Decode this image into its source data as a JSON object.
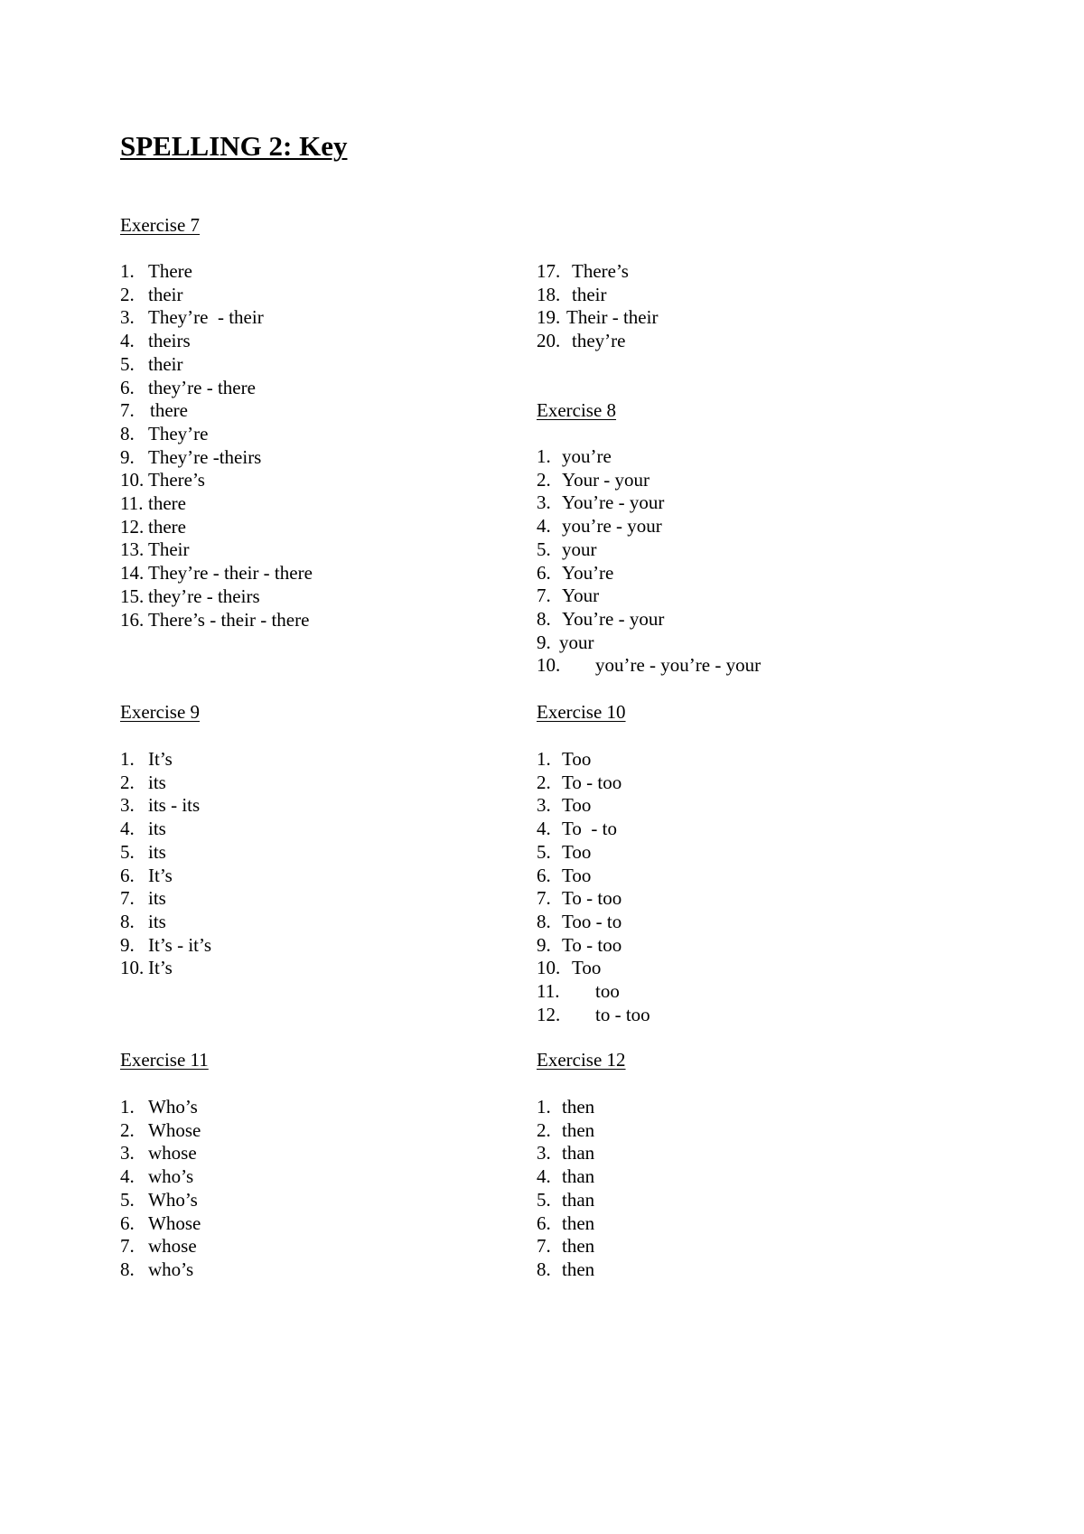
{
  "document": {
    "title": "SPELLING 2: Key"
  },
  "exercises": [
    {
      "header": "Exercise 7",
      "items": [
        {
          "num": "1.",
          "text": "There"
        },
        {
          "num": "2.",
          "text": "their"
        },
        {
          "num": "3.",
          "text": "They’re  - their"
        },
        {
          "num": "4.",
          "text": "theirs"
        },
        {
          "num": "5.",
          "text": "their"
        },
        {
          "num": "6.",
          "text": "they’re - there"
        },
        {
          "num": "7.",
          "text": "there"
        },
        {
          "num": "8.",
          "text": "They’re"
        },
        {
          "num": "9.",
          "text": "They’re -theirs"
        },
        {
          "num": "10.",
          "text": "There’s"
        },
        {
          "num": "11.",
          "text": "there"
        },
        {
          "num": "12.",
          "text": "there"
        },
        {
          "num": "13.",
          "text": "Their"
        },
        {
          "num": "14.",
          "text": "They’re - their - there"
        },
        {
          "num": "15.",
          "text": "they’re - theirs"
        },
        {
          "num": "16.",
          "text": "There’s - their - there"
        },
        {
          "num": "17.",
          "text": "There’s"
        },
        {
          "num": "18.",
          "text": "their"
        },
        {
          "num": "19.",
          "text": "Their - their"
        },
        {
          "num": "20.",
          "text": "they’re"
        }
      ]
    },
    {
      "header": "Exercise 8",
      "items": [
        {
          "num": "1.",
          "text": "you’re"
        },
        {
          "num": "2.",
          "text": "Your - your"
        },
        {
          "num": "3.",
          "text": "You’re - your"
        },
        {
          "num": "4.",
          "text": "you’re - your"
        },
        {
          "num": "5.",
          "text": "your"
        },
        {
          "num": "6.",
          "text": "You’re"
        },
        {
          "num": "7.",
          "text": "Your"
        },
        {
          "num": "8.",
          "text": "You’re - your"
        },
        {
          "num": "9.",
          "text": "your"
        },
        {
          "num": "10.",
          "text": "you’re - you’re - your"
        }
      ]
    },
    {
      "header": "Exercise 9",
      "items": [
        {
          "num": "1.",
          "text": "It’s"
        },
        {
          "num": "2.",
          "text": "its"
        },
        {
          "num": "3.",
          "text": "its - its"
        },
        {
          "num": "4.",
          "text": "its"
        },
        {
          "num": "5.",
          "text": "its"
        },
        {
          "num": "6.",
          "text": "It’s"
        },
        {
          "num": "7.",
          "text": "its"
        },
        {
          "num": "8.",
          "text": "its"
        },
        {
          "num": "9.",
          "text": "It’s - it’s"
        },
        {
          "num": "10.",
          "text": "It’s"
        }
      ]
    },
    {
      "header": "Exercise 10",
      "items": [
        {
          "num": "1.",
          "text": "Too"
        },
        {
          "num": "2.",
          "text": "To - too"
        },
        {
          "num": "3.",
          "text": "Too"
        },
        {
          "num": "4.",
          "text": "To  - to"
        },
        {
          "num": "5.",
          "text": "Too"
        },
        {
          "num": "6.",
          "text": "Too"
        },
        {
          "num": "7.",
          "text": "To - too"
        },
        {
          "num": "8.",
          "text": "Too - to"
        },
        {
          "num": "9.",
          "text": "To - too"
        },
        {
          "num": "10.",
          "text": "Too"
        },
        {
          "num": "11.",
          "text": "too"
        },
        {
          "num": "12.",
          "text": "to - too"
        }
      ]
    },
    {
      "header": "Exercise 11",
      "items": [
        {
          "num": "1.",
          "text": "Who’s"
        },
        {
          "num": "2.",
          "text": "Whose"
        },
        {
          "num": "3.",
          "text": "whose"
        },
        {
          "num": "4.",
          "text": "who’s"
        },
        {
          "num": "5.",
          "text": "Who’s"
        },
        {
          "num": "6.",
          "text": "Whose"
        },
        {
          "num": "7.",
          "text": "whose"
        },
        {
          "num": "8.",
          "text": "who’s"
        }
      ]
    },
    {
      "header": "Exercise 12",
      "items": [
        {
          "num": "1.",
          "text": "then"
        },
        {
          "num": "2.",
          "text": "then"
        },
        {
          "num": "3.",
          "text": "than"
        },
        {
          "num": "4.",
          "text": "than"
        },
        {
          "num": "5.",
          "text": "than"
        },
        {
          "num": "6.",
          "text": "then"
        },
        {
          "num": "7.",
          "text": "then"
        },
        {
          "num": "8.",
          "text": "then"
        }
      ]
    }
  ]
}
